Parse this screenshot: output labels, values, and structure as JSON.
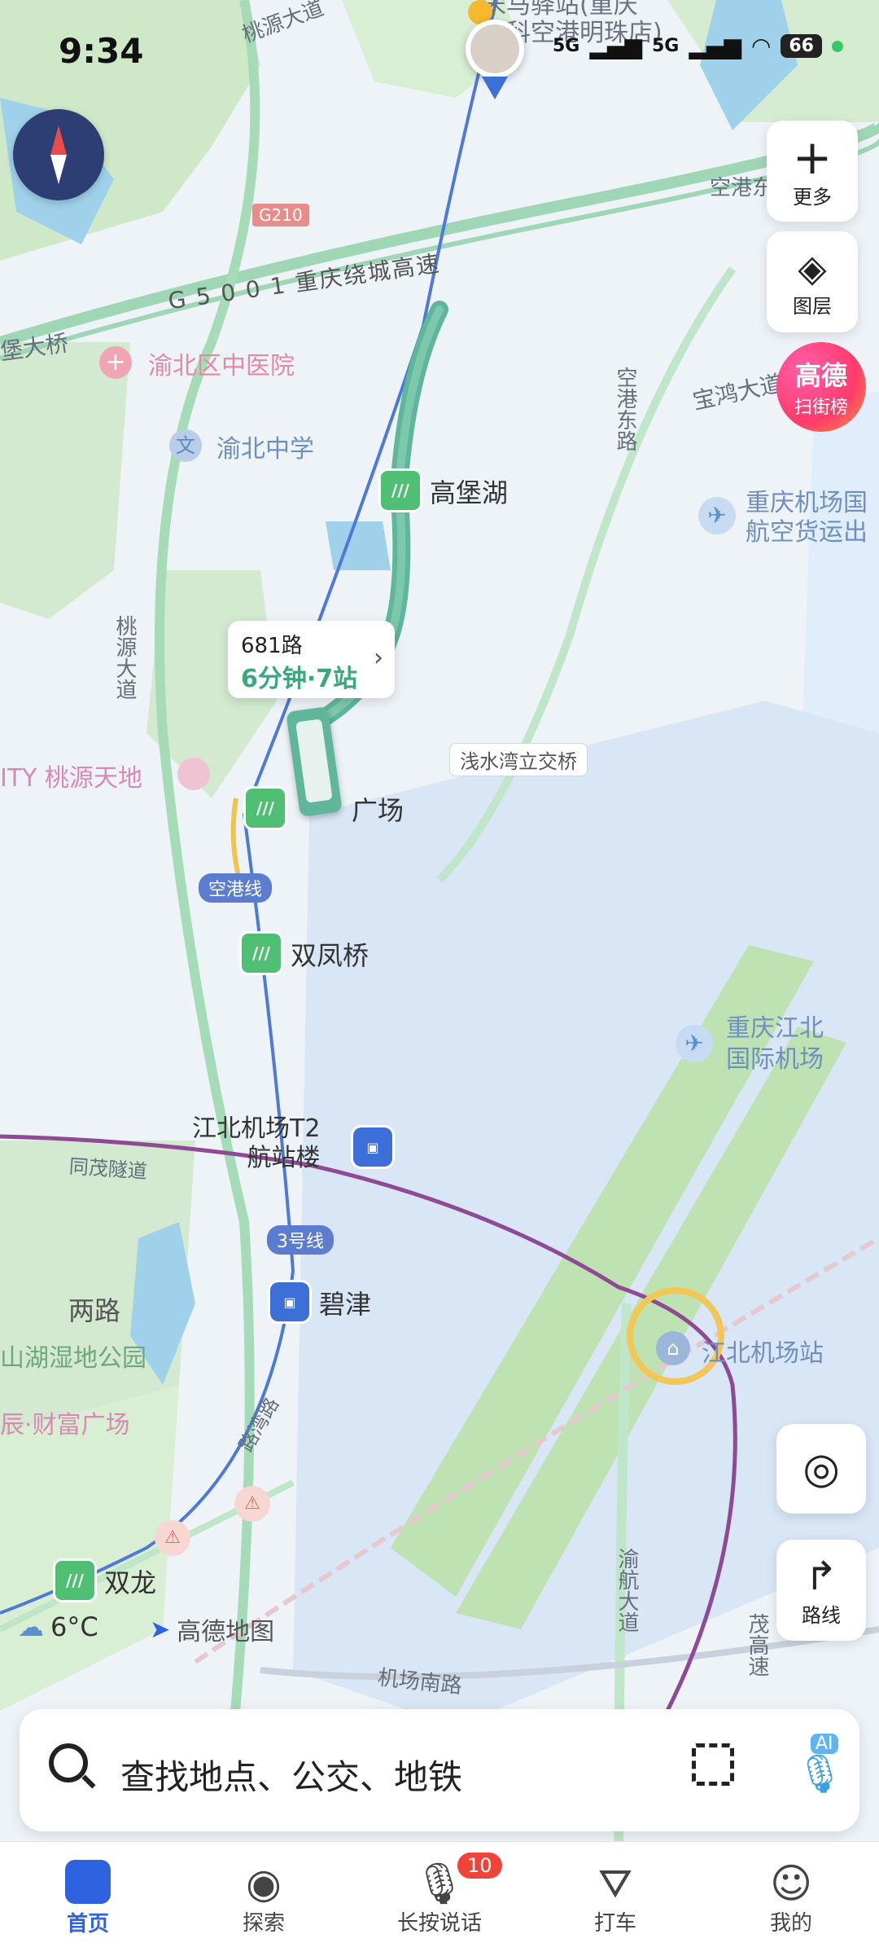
{
  "status_bar": {
    "time": "9:34",
    "signal1": "5G",
    "signal2": "5G",
    "battery": "66"
  },
  "map": {
    "labels": {
      "taoyuan_ave_top": "桃源大道",
      "station_top": "宋马驿站(重庆",
      "station_top2": "泽科空港明珠店)",
      "g210": "G210",
      "g5001": "G 5 0 0 1 重庆绕城高速",
      "bridge": "堡大桥",
      "hospital": "渝北区中医院",
      "school": "渝北中学",
      "gaobao_lake": "高堡湖",
      "konggang_east_road": "空港东路",
      "konggang_east": "空港东",
      "baohong_ave": "宝鸿大道",
      "airport_cargo1": "重庆机场国",
      "airport_cargo2": "航空货运出",
      "taoyuan_ave_left": "桃源大道",
      "city_taoyuan": "ITY 桃源天地",
      "qianshuiwan": "浅水湾立交桥",
      "plaza": "广场",
      "airport_line": "空港线",
      "shuangfeng": "双凤桥",
      "airport1": "重庆江北",
      "airport2": "国际机场",
      "t2_1": "江北机场T2",
      "t2_2": "航站楼",
      "tongmao": "同茂隧道",
      "line3": "3号线",
      "liang_road": "两路",
      "bijin": "碧津",
      "wetland": "山湖湿地公园",
      "jiangbei_station": "江北机场站",
      "caifu": "辰·财富广场",
      "shuanglong": "双龙",
      "yuhang_ave": "渝航大道",
      "airport_south": "机场南路",
      "temp": "6°C",
      "brand": "高德地图",
      "road_south": "路湾路",
      "rightroad": "茂高速"
    },
    "bus_popup": {
      "route": "681路",
      "eta": "6分钟·7站"
    }
  },
  "right_controls": {
    "more": "更多",
    "layers": "图层",
    "gaode_line1": "高德",
    "gaode_line2": "扫街榜",
    "route": "路线"
  },
  "search": {
    "placeholder": "查找地点、公交、地铁",
    "ai": "AI"
  },
  "bottom_nav": {
    "items": [
      {
        "label": "首页"
      },
      {
        "label": "探索"
      },
      {
        "label": "长按说话",
        "badge": "10"
      },
      {
        "label": "打车"
      },
      {
        "label": "我的"
      }
    ]
  },
  "colors": {
    "accent": "#2f62e0",
    "bus_green": "#4fbf73",
    "metro_blue": "#3d6fd9",
    "route_teal": "#5fb69a"
  }
}
